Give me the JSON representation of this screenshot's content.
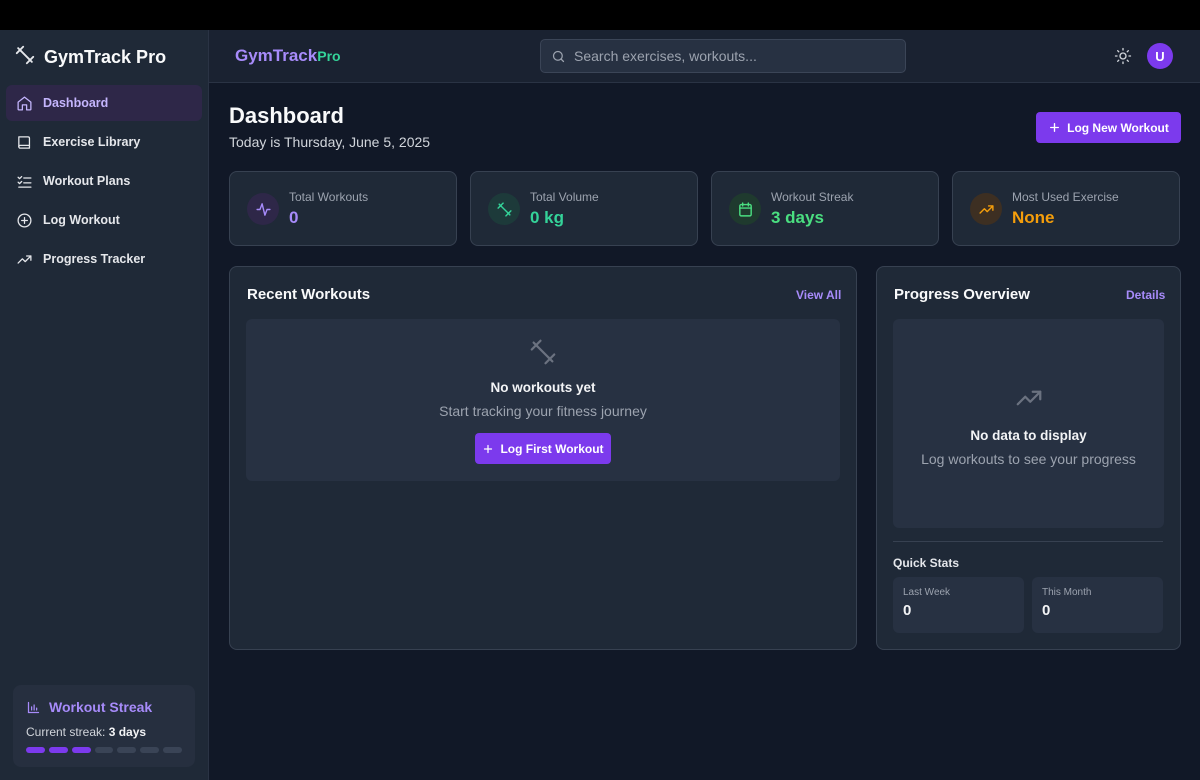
{
  "app": {
    "sidebar_brand": "GymTrack Pro",
    "header_logo_main": "GymTrack",
    "header_logo_suffix": "Pro"
  },
  "colors": {
    "accent": "#7c3aed",
    "accent_light": "#a78bfa",
    "green": "#34d399",
    "streak_green": "#4ade80",
    "orange": "#f59e0b"
  },
  "sidebar": {
    "items": [
      {
        "label": "Dashboard",
        "icon": "home-icon",
        "active": true
      },
      {
        "label": "Exercise Library",
        "icon": "book-icon"
      },
      {
        "label": "Workout Plans",
        "icon": "list-check-icon"
      },
      {
        "label": "Log Workout",
        "icon": "plus-circle-icon"
      },
      {
        "label": "Progress Tracker",
        "icon": "trending-up-icon"
      }
    ],
    "streak": {
      "title": "Workout Streak",
      "current_prefix": "Current streak:",
      "current_value": "3 days",
      "filled": 3,
      "total": 7
    }
  },
  "search": {
    "placeholder": "Search exercises, workouts..."
  },
  "header": {
    "avatar_initial": "U"
  },
  "main": {
    "title": "Dashboard",
    "subtitle": "Today is Thursday, June 5, 2025",
    "log_new_label": "Log New Workout",
    "stats": [
      {
        "label": "Total Workouts",
        "value": "0",
        "icon": "activity-icon"
      },
      {
        "label": "Total Volume",
        "value": "0 kg",
        "icon": "dumbbell-icon"
      },
      {
        "label": "Workout Streak",
        "value": "3 days",
        "icon": "calendar-icon"
      },
      {
        "label": "Most Used Exercise",
        "value": "None",
        "icon": "trending-up-icon"
      }
    ],
    "recent": {
      "title": "Recent Workouts",
      "link": "View All",
      "empty_title": "No workouts yet",
      "empty_sub": "Start tracking your fitness journey",
      "cta": "Log First Workout"
    },
    "progress": {
      "title": "Progress Overview",
      "link": "Details",
      "empty_title": "No data to display",
      "empty_sub": "Log workouts to see your progress",
      "quick_stats_title": "Quick Stats",
      "quick_stats": [
        {
          "label": "Last Week",
          "value": "0"
        },
        {
          "label": "This Month",
          "value": "0"
        }
      ]
    }
  }
}
